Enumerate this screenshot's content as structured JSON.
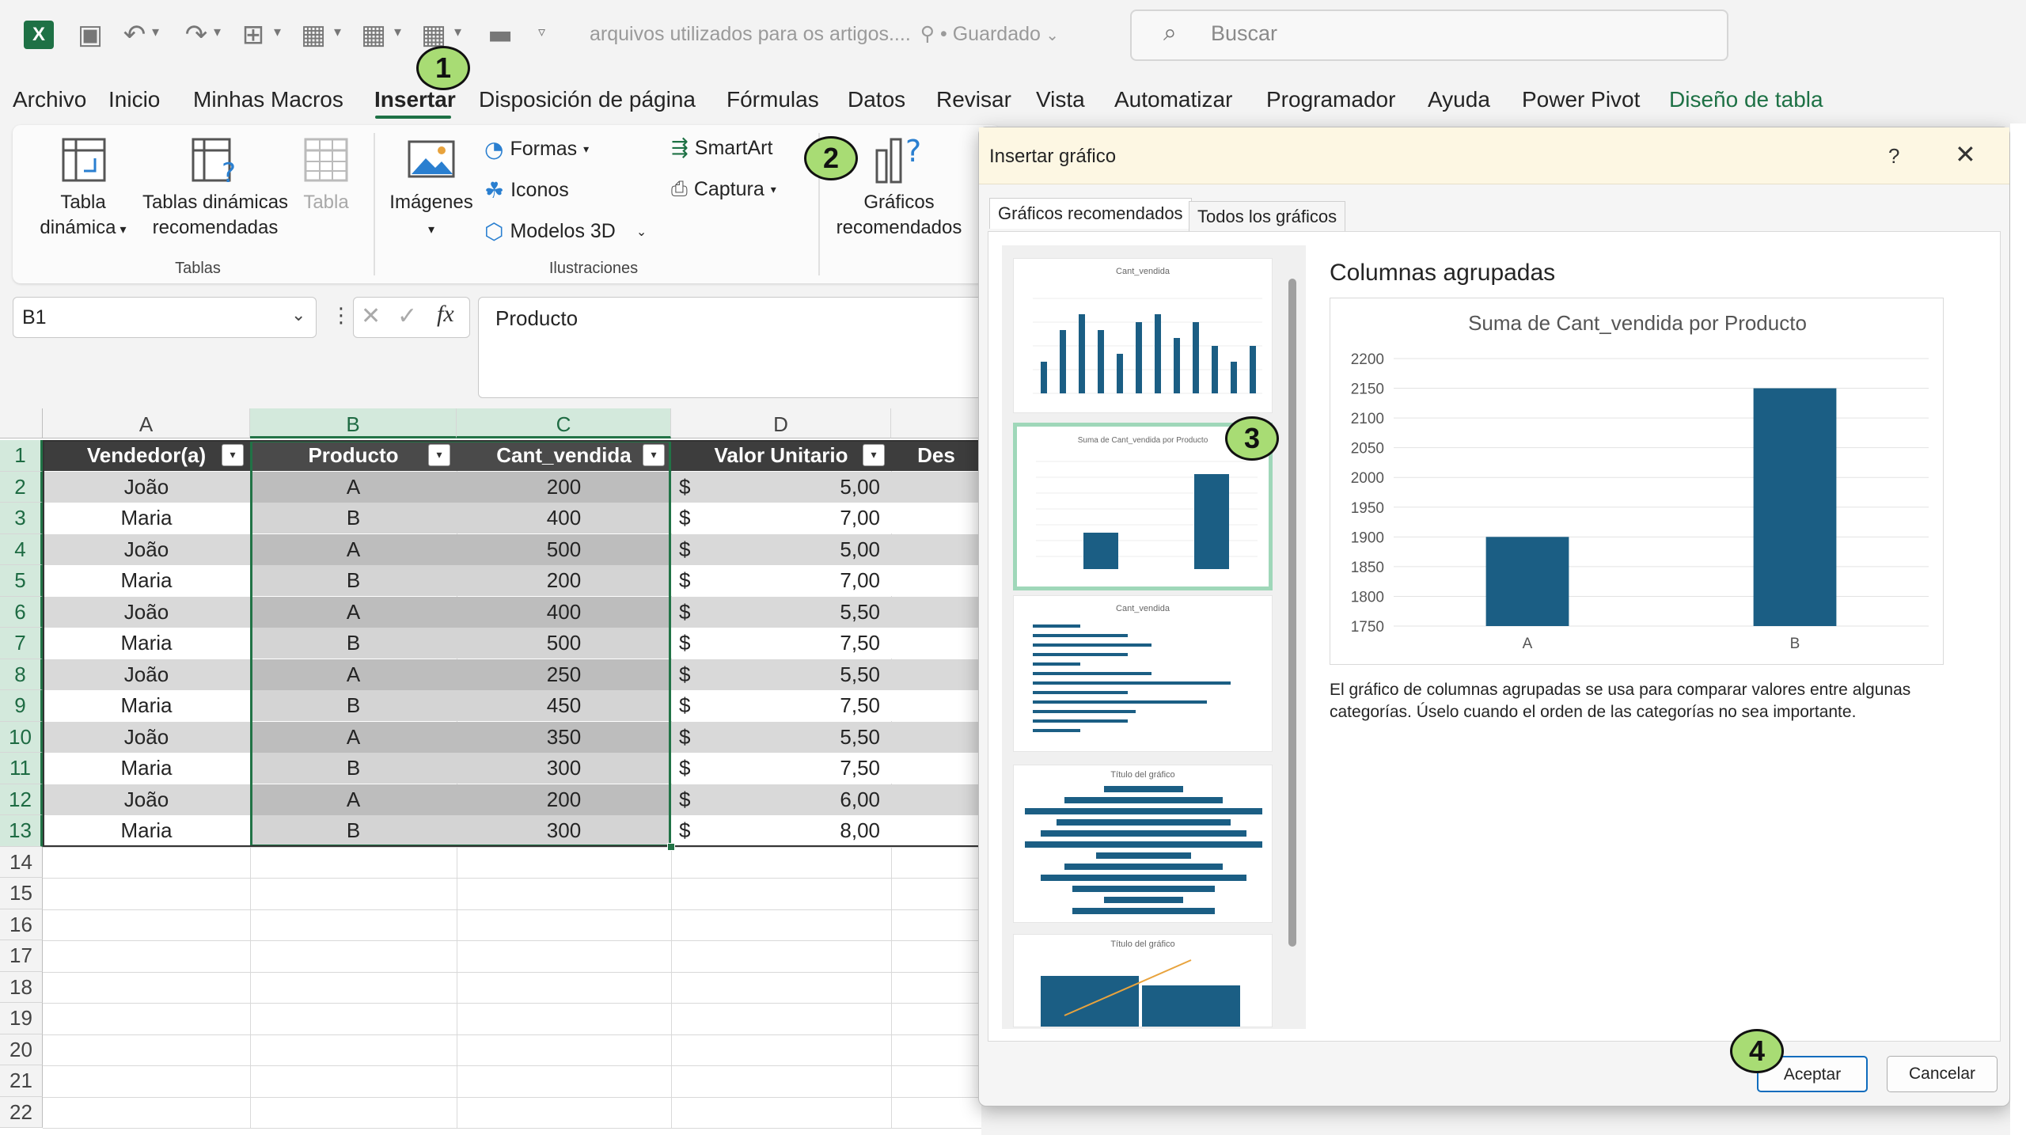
{
  "titlebar": {
    "doc_name": "arquivos utilizados para os artigos....",
    "saved": "• Guardado",
    "search_placeholder": "Buscar"
  },
  "menu": [
    "Archivo",
    "Inicio",
    "Minhas Macros",
    "Insertar",
    "Disposición de página",
    "Fórmulas",
    "Datos",
    "Revisar",
    "Vista",
    "Automatizar",
    "Programador",
    "Ayuda",
    "Power Pivot",
    "Diseño de tabla"
  ],
  "ribbon": {
    "tabla_dinamica": [
      "Tabla",
      "dinámica"
    ],
    "tablas_recomendadas": [
      "Tablas dinámicas",
      "recomendadas"
    ],
    "tabla": "Tabla",
    "group_tablas": "Tablas",
    "imagenes": "Imágenes",
    "formas": "Formas",
    "iconos": "Iconos",
    "modelos3d": "Modelos 3D",
    "smartart": "SmartArt",
    "captura": "Captura",
    "group_ilustraciones": "Ilustraciones",
    "graficos_recomendados": [
      "Gráficos",
      "recomendados"
    ]
  },
  "formula_bar": {
    "name_box": "B1",
    "fx": "fx",
    "value": "Producto"
  },
  "sheet": {
    "columns": [
      "A",
      "B",
      "C",
      "D"
    ],
    "headers": [
      "Vendedor(a)",
      "Producto",
      "Cant_vendida",
      "Valor Unitario",
      "Des"
    ],
    "rows": [
      [
        "João",
        "A",
        "200",
        "$",
        "5,00"
      ],
      [
        "Maria",
        "B",
        "400",
        "$",
        "7,00"
      ],
      [
        "João",
        "A",
        "500",
        "$",
        "5,00"
      ],
      [
        "Maria",
        "B",
        "200",
        "$",
        "7,00"
      ],
      [
        "João",
        "A",
        "400",
        "$",
        "5,50"
      ],
      [
        "Maria",
        "B",
        "500",
        "$",
        "7,50"
      ],
      [
        "João",
        "A",
        "250",
        "$",
        "5,50"
      ],
      [
        "Maria",
        "B",
        "450",
        "$",
        "7,50"
      ],
      [
        "João",
        "A",
        "350",
        "$",
        "5,50"
      ],
      [
        "Maria",
        "B",
        "300",
        "$",
        "7,50"
      ],
      [
        "João",
        "A",
        "200",
        "$",
        "6,00"
      ],
      [
        "Maria",
        "B",
        "300",
        "$",
        "8,00"
      ]
    ],
    "row_numbers": [
      "1",
      "2",
      "3",
      "4",
      "5",
      "6",
      "7",
      "8",
      "9",
      "10",
      "11",
      "12",
      "13",
      "14",
      "15",
      "16",
      "17",
      "18",
      "19",
      "20",
      "21",
      "22"
    ]
  },
  "dialog": {
    "title": "Insertar gráfico",
    "help": "?",
    "tabs": [
      "Gráficos recomendados",
      "Todos los gráficos"
    ],
    "thumb_titles": [
      "Cant_vendida",
      "Suma de Cant_vendida por Producto",
      "Cant_vendida",
      "Título del gráfico",
      "Título del gráfico"
    ],
    "preview_title": "Columnas agrupadas",
    "description": "El gráfico de columnas agrupadas se usa para comparar valores entre algunas categorías. Úselo cuando el orden de las categorías no sea importante.",
    "ok": "Aceptar",
    "cancel": "Cancelar"
  },
  "badges": [
    "1",
    "2",
    "3",
    "4"
  ],
  "badge_color": "#a8dc74",
  "accent_color": "#217346",
  "chart_data": {
    "type": "bar",
    "title": "Suma de Cant_vendida por Producto",
    "categories": [
      "A",
      "B"
    ],
    "values": [
      1900,
      2150
    ],
    "ylim": [
      1750,
      2200
    ],
    "yticks": [
      "1750",
      "1800",
      "1850",
      "1900",
      "1950",
      "2000",
      "2050",
      "2100",
      "2150",
      "2200"
    ],
    "bar_color": "#1b5e84",
    "grid": true
  }
}
